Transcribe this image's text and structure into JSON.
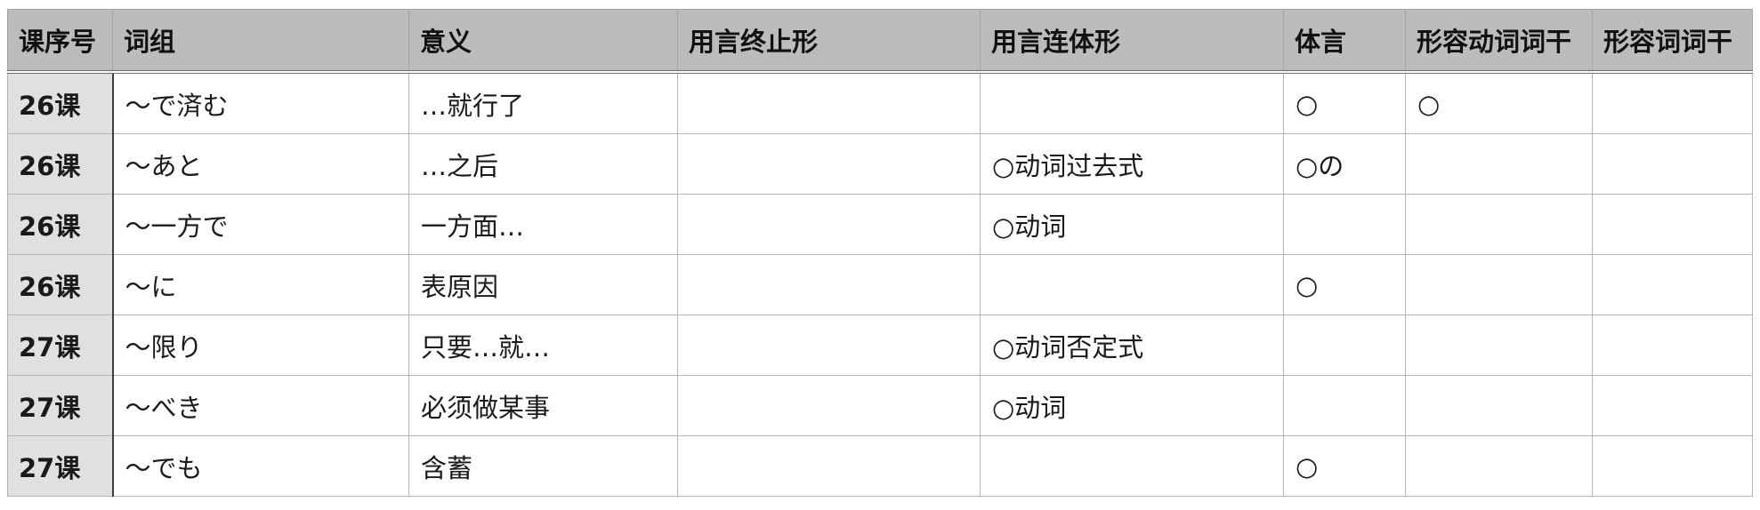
{
  "table": {
    "headers": [
      "课序号",
      "词组",
      "意义",
      "用言终止形",
      "用言连体形",
      "体言",
      "形容动词词干",
      "形容词词干"
    ],
    "rows": [
      [
        "26课",
        "～で済む",
        "…就行了",
        "",
        "",
        "○",
        "○",
        ""
      ],
      [
        "26课",
        "～あと",
        "…之后",
        "",
        "○动词过去式",
        "○の",
        "",
        ""
      ],
      [
        "26课",
        "～一方で",
        "一方面…",
        "",
        "○动词",
        "",
        "",
        ""
      ],
      [
        "26课",
        "～に",
        "表原因",
        "",
        "",
        "○",
        "",
        ""
      ],
      [
        "27课",
        "～限り",
        "只要…就…",
        "",
        "○动词否定式",
        "",
        "",
        ""
      ],
      [
        "27课",
        "～べき",
        "必须做某事",
        "",
        "○动词",
        "",
        "",
        ""
      ],
      [
        "27课",
        "～でも",
        "含蓄",
        "",
        "",
        "○",
        "",
        ""
      ]
    ]
  },
  "colors": {
    "header_bg": "#bcbcbc",
    "lesson_column_bg": "#e0e0e0",
    "grid_line": "#b5b5b5"
  }
}
